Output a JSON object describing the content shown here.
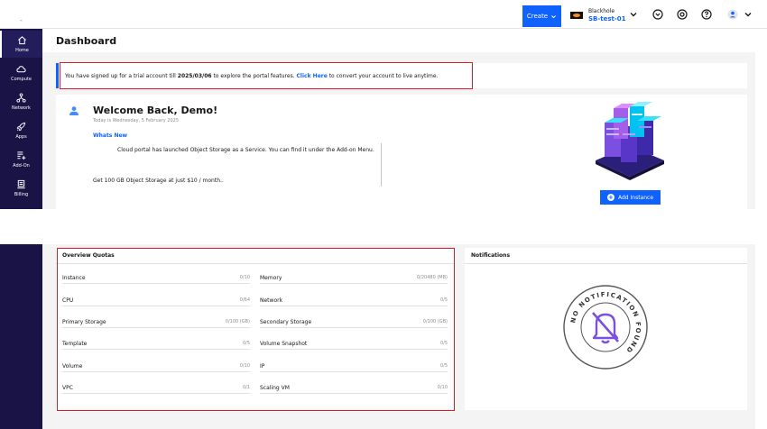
{
  "topbar": {
    "create_label": "Create",
    "tenant_name": "Blackhole",
    "tenant_sub": "SB-test-01",
    "icons": [
      "chevron-down-icon",
      "circle-chevron-icon",
      "at-icon",
      "help-icon",
      "user-icon"
    ]
  },
  "sidebar": {
    "items": [
      {
        "label": "Home",
        "icon": "home-icon"
      },
      {
        "label": "Compute",
        "icon": "cloud-icon"
      },
      {
        "label": "Network",
        "icon": "network-icon"
      },
      {
        "label": "Apps",
        "icon": "rocket-icon"
      },
      {
        "label": "Add-On",
        "icon": "add-on-icon"
      },
      {
        "label": "Billing",
        "icon": "billing-icon"
      }
    ]
  },
  "page": {
    "title": "Dashboard"
  },
  "trial": {
    "text_before": "You have signed up for a trial account till ",
    "date": "2025/03/06",
    "text_middle": " to explore the portal features. ",
    "link": "Click Here",
    "text_after": " to convert your account to live anytime."
  },
  "welcome": {
    "title": "Welcome Back, Demo!",
    "date": "Today is Wednesday, 5 February 2025",
    "whats_new": "Whats New",
    "news": [
      "Cloud portal has launched Object Storage as a Service. You can find it under the Add-on Menu.",
      "Get 100 GB Object Storage at just $10 / month.."
    ],
    "add_instance": "Add Instance"
  },
  "quotas": {
    "title": "Overview Quotas",
    "left": [
      {
        "name": "Instance",
        "value": "0/10"
      },
      {
        "name": "CPU",
        "value": "0/64"
      },
      {
        "name": "Primary Storage",
        "value": "0/100 (GB)"
      },
      {
        "name": "Template",
        "value": "0/5"
      },
      {
        "name": "Volume",
        "value": "0/10"
      },
      {
        "name": "VPC",
        "value": "0/1"
      }
    ],
    "right": [
      {
        "name": "Memory",
        "value": "0/20480 (MB)"
      },
      {
        "name": "Network",
        "value": "0/5"
      },
      {
        "name": "Secondary Storage",
        "value": "0/100 (GB)"
      },
      {
        "name": "Volume Snapshot",
        "value": "0/5"
      },
      {
        "name": "IP",
        "value": "0/5"
      },
      {
        "name": "Scaling VM",
        "value": "0/10"
      }
    ]
  },
  "notifications": {
    "title": "Notifications",
    "stamp_text": "NO NOTIFICATION FOUND"
  },
  "colors": {
    "accent": "#0f62fe",
    "sidebar": "#1a1446",
    "highlight": "#da1e28",
    "stamp": "#7b4fe0"
  }
}
